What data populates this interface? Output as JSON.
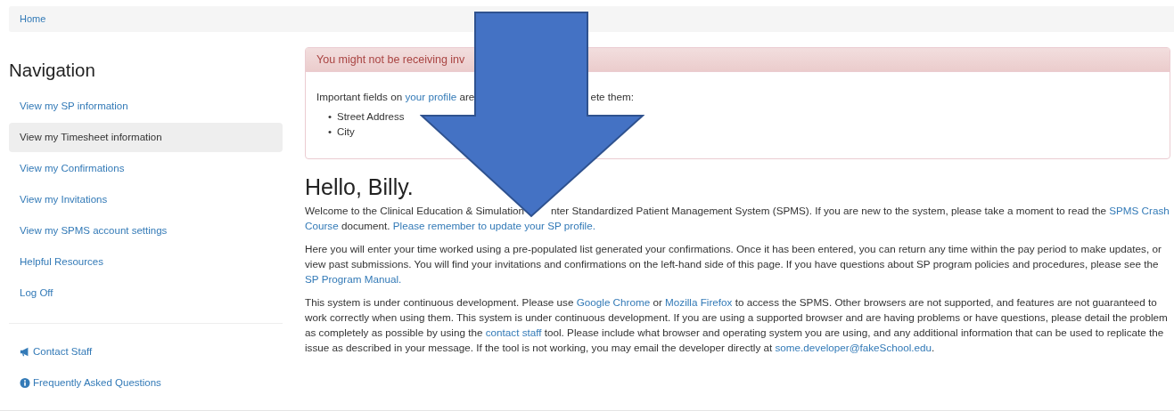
{
  "breadcrumb": {
    "label": "Home"
  },
  "sidebar": {
    "heading": "Navigation",
    "items": [
      {
        "label": "View my SP information",
        "selected": false
      },
      {
        "label": "View my Timesheet information",
        "selected": true
      },
      {
        "label": "View my Confirmations",
        "selected": false
      },
      {
        "label": "View my Invitations",
        "selected": false
      },
      {
        "label": "View my SPMS account settings",
        "selected": false
      },
      {
        "label": "Helpful Resources",
        "selected": false
      },
      {
        "label": "Log Off",
        "selected": false
      }
    ],
    "extra_links": [
      {
        "label": "Contact Staff",
        "kind": "megaphone"
      },
      {
        "label": "Frequently Asked Questions",
        "kind": "info"
      }
    ]
  },
  "alert": {
    "title": "You might not be receiving inv",
    "body": [
      {
        "kind": "text",
        "text": "Important fields on "
      },
      {
        "kind": "link",
        "text": "your profile"
      },
      {
        "kind": "text",
        "text": " are",
        "covered_after": true
      },
      {
        "kind": "text",
        "text": "ete them:"
      }
    ],
    "list_marker": "•",
    "missing_fields": [
      "Street Address",
      "City"
    ]
  },
  "greeting": "Hello, Billy.",
  "paragraphs": [
    [
      {
        "kind": "text",
        "text": "Welcome to the Clinical Education & Simulation",
        "covered_after": true
      },
      {
        "kind": "text",
        "text": "nter Standardized Patient Management System (SPMS). If you are new to the system, please take a moment to read the "
      },
      {
        "kind": "link",
        "text": "SPMS Crash"
      },
      {
        "kind": "link",
        "text": "Course"
      },
      {
        "kind": "text",
        "text": " document. "
      },
      {
        "kind": "link",
        "text": "Please remember to update your SP profile."
      }
    ],
    [
      {
        "kind": "text",
        "text": "Here you will enter your time worked using a pre-populated list generated your confirmations. Once it has been entered, you can return any time within the pay period to make updates, or view past submissions. You will find your invitations and confirmations on the left-hand side of this page. If you have questions about SP program policies and procedures, please see the "
      },
      {
        "kind": "link",
        "text": "SP Program Manual."
      }
    ],
    [
      {
        "kind": "text",
        "text": "This system is under continuous development. Please use "
      },
      {
        "kind": "link",
        "text": "Google Chrome"
      },
      {
        "kind": "text",
        "text": " or "
      },
      {
        "kind": "link",
        "text": "Mozilla Firefox"
      },
      {
        "kind": "text",
        "text": " to access the SPMS. Other browsers are not supported, and features are not guaranteed to work correctly when using them. This system is under continuous development. If you are using a supported browser and are having problems or have questions, please detail the problem as completely as possible by using the "
      },
      {
        "kind": "link",
        "text": "contact staff"
      },
      {
        "kind": "text",
        "text": " tool. Please include what browser and operating system you are using, and any additional information that can be used to replicate the issue as described in your message. If the tool is not working, you may email the developer directly at "
      },
      {
        "kind": "link",
        "text": "some.developer@fakeSchool.edu"
      },
      {
        "kind": "text",
        "text": "."
      }
    ]
  ]
}
